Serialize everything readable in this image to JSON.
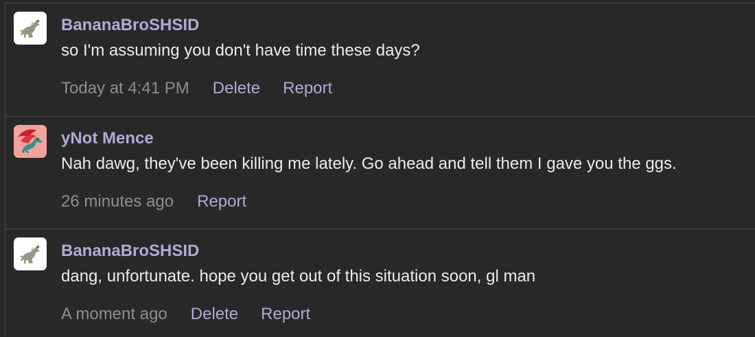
{
  "messages": [
    {
      "author": "BananaBroSHSID",
      "avatar_icon": "dinosaur-avatar-icon",
      "avatar_bg": "#ffffff",
      "text": "so I'm assuming you don't have time these days?",
      "time": "Today at 4:41 PM",
      "delete_label": "Delete",
      "report_label": "Report"
    },
    {
      "author": "yNot Mence",
      "avatar_icon": "dragon-avatar-icon",
      "avatar_bg": "#f4a29c",
      "text": "Nah dawg, they've been killing me lately. Go ahead and tell them I gave you the ggs.",
      "time": "26 minutes ago",
      "report_label": "Report"
    },
    {
      "author": "BananaBroSHSID",
      "avatar_icon": "dinosaur-avatar-icon",
      "avatar_bg": "#ffffff",
      "text": "dang, unfortunate. hope you get out of this situation soon, gl man",
      "time": "A moment ago",
      "delete_label": "Delete",
      "report_label": "Report"
    }
  ],
  "colors": {
    "background": "#282828",
    "author": "#b4a8d4",
    "text": "#ececec",
    "muted": "#8f8f8f",
    "divider": "#4a4a4a"
  }
}
